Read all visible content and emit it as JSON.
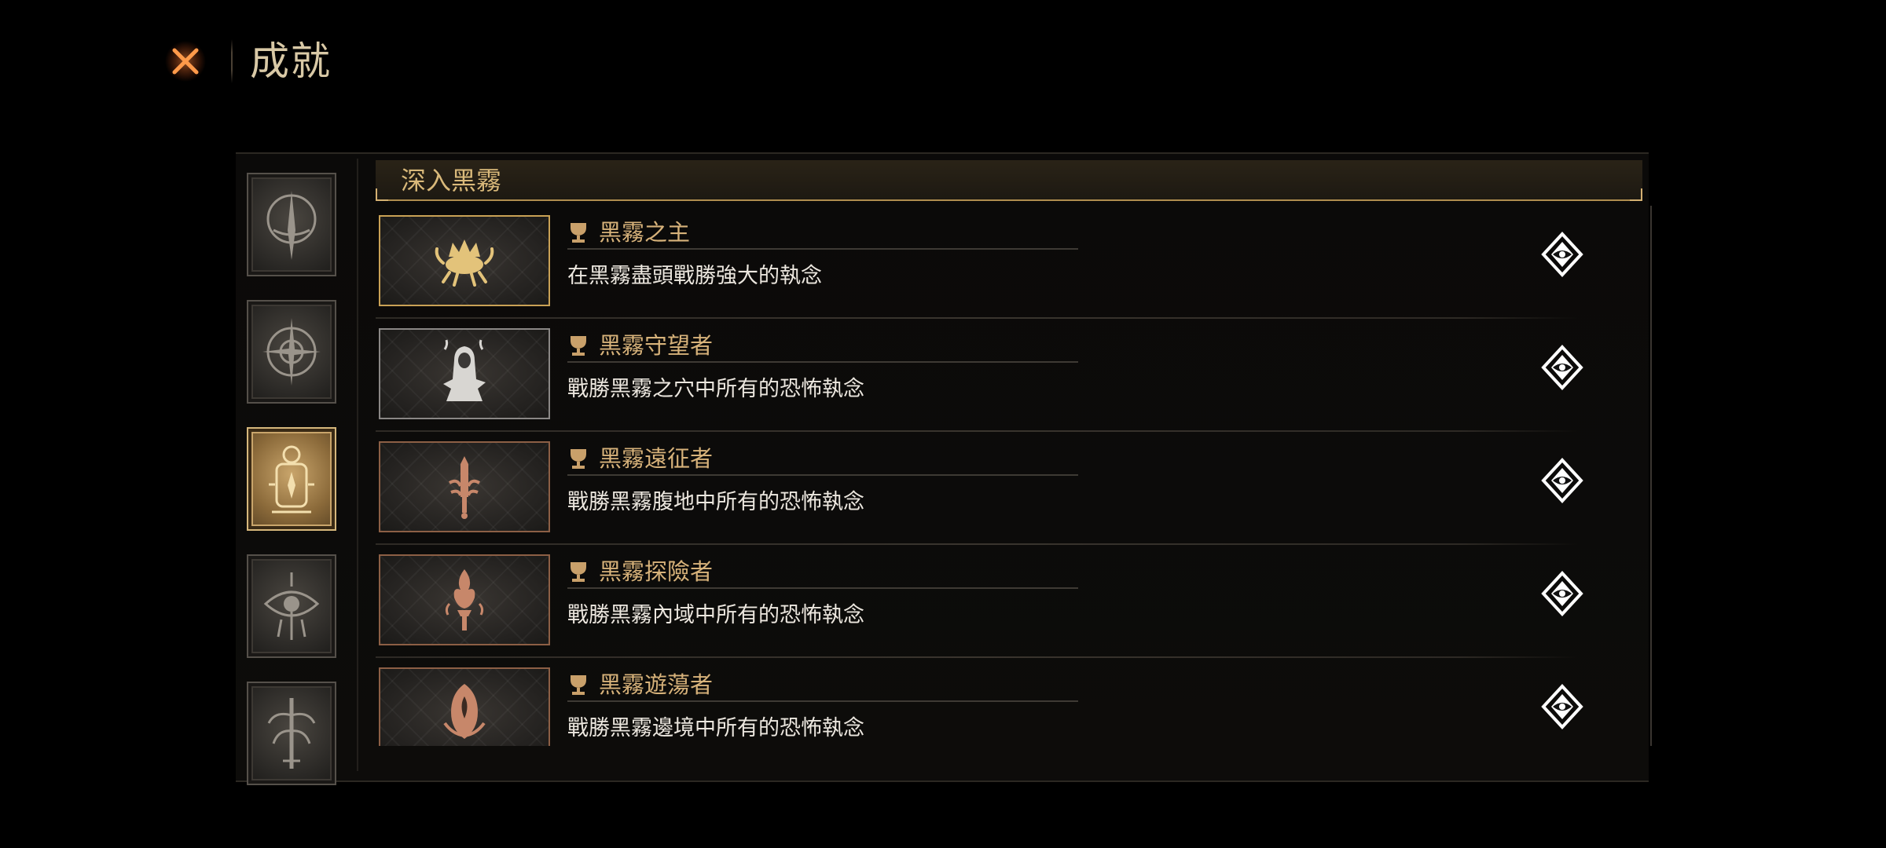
{
  "header": {
    "title": "成就",
    "close_icon": "close-x-icon"
  },
  "colors": {
    "background": "#000000",
    "gold_accent": "#d9b97a",
    "title_gold": "#d7b27a",
    "text_light": "#ece7df",
    "active_tab": "#c9a56b"
  },
  "categories": [
    {
      "icon": "spire-icon",
      "active": false
    },
    {
      "icon": "compass-icon",
      "active": false
    },
    {
      "icon": "lantern-icon",
      "active": true
    },
    {
      "icon": "eye-sigil-icon",
      "active": false
    },
    {
      "icon": "tree-sigil-icon",
      "active": false
    }
  ],
  "section": {
    "title": "深入黑霧"
  },
  "achievements": [
    {
      "title": "黑霧之主",
      "description": "在黑霧盡頭戰勝強大的執念",
      "tier": "gold",
      "badge_icon": "crown-crab-icon"
    },
    {
      "title": "黑霧守望者",
      "description": "戰勝黑霧之穴中所有的恐怖執念",
      "tier": "silver",
      "badge_icon": "hooded-figure-icon"
    },
    {
      "title": "黑霧遠征者",
      "description": "戰勝黑霧腹地中所有的恐怖執念",
      "tier": "bronze",
      "badge_icon": "sword-icon"
    },
    {
      "title": "黑霧探險者",
      "description": "戰勝黑霧內域中所有的恐怖執念",
      "tier": "bronze",
      "badge_icon": "torch-icon"
    },
    {
      "title": "黑霧遊蕩者",
      "description": "戰勝黑霧邊境中所有的恐怖執念",
      "tier": "bronze",
      "badge_icon": "cloak-icon"
    }
  ]
}
